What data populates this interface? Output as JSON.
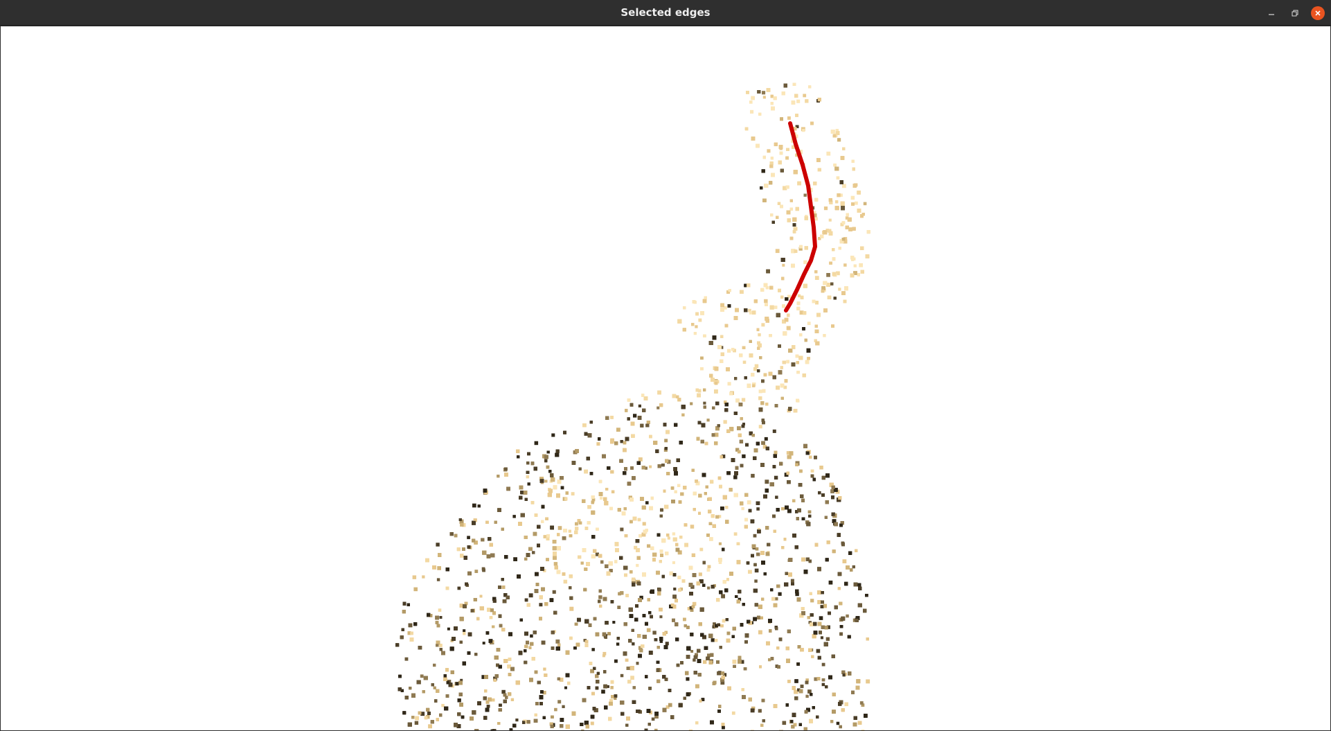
{
  "window": {
    "title": "Selected edges",
    "controls": {
      "minimize_icon": "minimize-icon",
      "maximize_icon": "restore-icon",
      "close_icon": "close-icon"
    }
  },
  "viewer": {
    "background": "#ffffff",
    "point_colors": [
      "#2f2718",
      "#4a3d27",
      "#6b5a3b",
      "#8f7a52",
      "#b39a66",
      "#d2b57a",
      "#e8c98e",
      "#f3d9a3",
      "#fbe6b8"
    ],
    "selected_edge_color": "#cc0000"
  }
}
